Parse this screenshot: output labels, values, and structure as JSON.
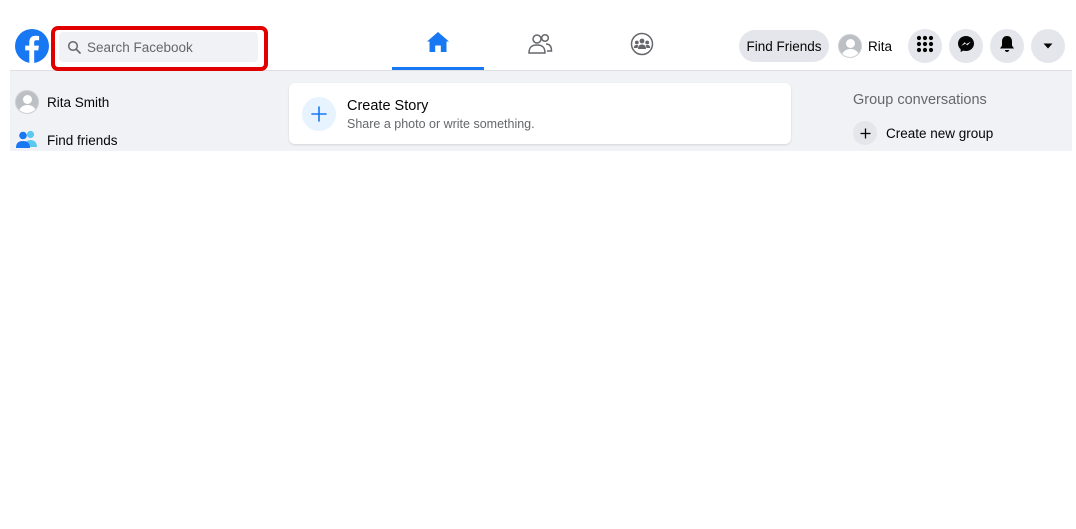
{
  "header": {
    "logo_icon": "facebook-logo-icon",
    "search": {
      "placeholder": "Search Facebook",
      "value": ""
    },
    "tabs": [
      {
        "name": "home",
        "icon": "home-icon",
        "active": true
      },
      {
        "name": "friends",
        "icon": "friends-icon",
        "active": false
      },
      {
        "name": "groups",
        "icon": "groups-icon",
        "active": false
      }
    ],
    "find_friends_label": "Find Friends",
    "profile_name": "Rita",
    "menu_icon": "grid-menu-icon",
    "messenger_icon": "messenger-icon",
    "notifications_icon": "bell-icon",
    "account_icon": "caret-down-icon"
  },
  "sidebar": {
    "items": [
      {
        "label": "Rita Smith",
        "icon": "avatar"
      },
      {
        "label": "Find friends",
        "icon": "friends-icon"
      }
    ]
  },
  "feed": {
    "create_story": {
      "title": "Create Story",
      "subtitle": "Share a photo or write something."
    }
  },
  "right_panel": {
    "heading": "Group conversations",
    "create_group_label": "Create new group"
  },
  "colors": {
    "accent": "#1877f2",
    "highlight_box": "#e00000",
    "background": "#f0f2f5"
  }
}
